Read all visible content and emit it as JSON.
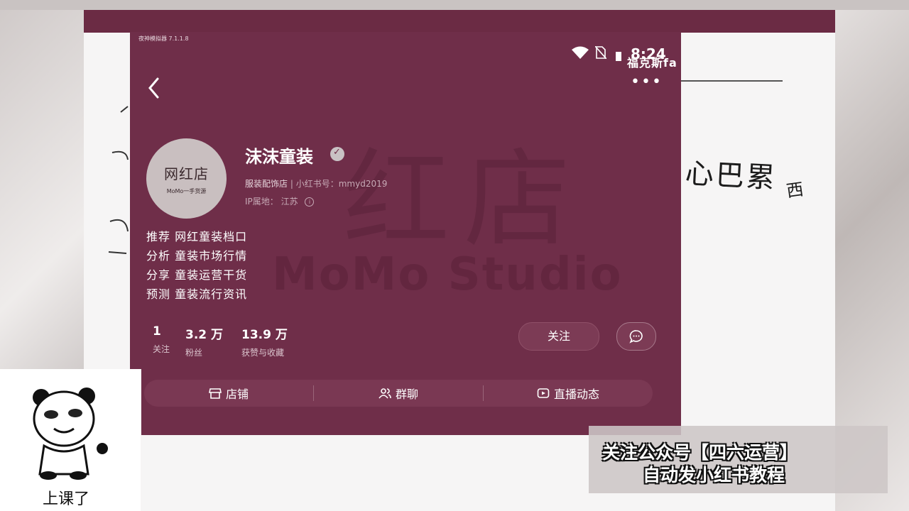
{
  "status_bar": {
    "window_label": "夜神模拟器 7.1.1.8",
    "time": "8:24",
    "overlay_name": "福克斯fa"
  },
  "watermark": {
    "big": "红店",
    "en": "MoMo Studio"
  },
  "profile": {
    "avatar_text": "网红店",
    "avatar_sub": "MoMo一手货源",
    "name": "沫沫童装",
    "category": "服装配饰店",
    "id_label": "小红书号：",
    "id_value": "mmyd2019",
    "ip_label": "IP属地：",
    "ip_value": "江苏"
  },
  "bio": [
    "推荐 网红童装档口",
    "分析 童装市场行情",
    "分享 童装运营干货",
    "预测 童装流行资讯"
  ],
  "stats": [
    {
      "value": "1",
      "label": "关注"
    },
    {
      "value": "3.2 万",
      "label": "粉丝"
    },
    {
      "value": "13.9 万",
      "label": "获赞与收藏"
    }
  ],
  "actions": {
    "follow": "关注"
  },
  "tabs": [
    {
      "label": "店铺",
      "icon": "shop-icon"
    },
    {
      "label": "群聊",
      "icon": "group-icon"
    },
    {
      "label": "直播动态",
      "icon": "live-icon"
    }
  ],
  "handwriting": {
    "right": "心巴累",
    "small": "西"
  },
  "meme": {
    "caption": "上课了"
  },
  "promo": {
    "line1": "关注公众号【四六运营】",
    "line2": "自动发小红书教程"
  },
  "colors": {
    "profile_bg": "#6f2e49",
    "accent": "#7a3853"
  }
}
